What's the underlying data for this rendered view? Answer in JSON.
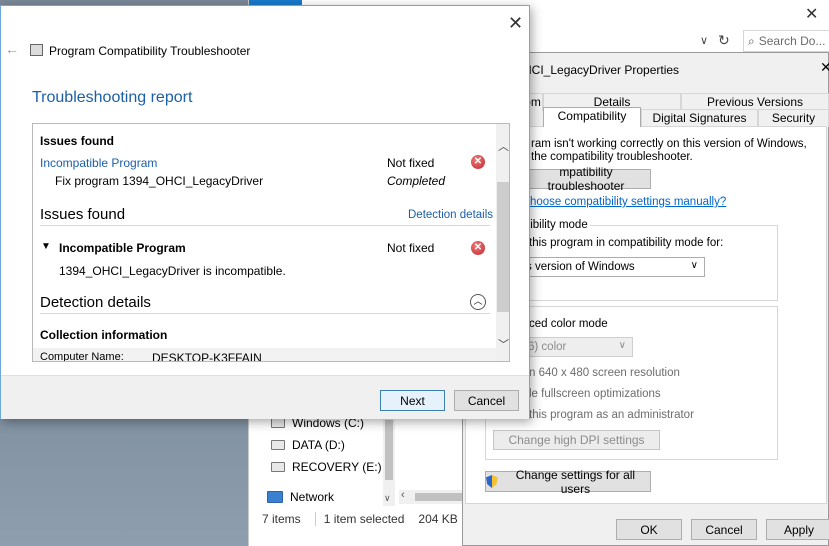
{
  "troubleshooter": {
    "app_title": "Program Compatibility Troubleshooter",
    "report_title": "Troubleshooting report",
    "summary": {
      "heading": "Issues found",
      "issue": "Incompatible Program",
      "issue_status": "Not fixed",
      "fix": "Fix program 1394_OHCI_LegacyDriver",
      "fix_status": "Completed"
    },
    "issues_section": {
      "heading": "Issues found",
      "detail_link": "Detection details",
      "issue": "Incompatible Program",
      "issue_status": "Not fixed",
      "issue_desc": "1394_OHCI_LegacyDriver is incompatible."
    },
    "detection": {
      "heading": "Detection details",
      "collection": "Collection information",
      "computer_label": "Computer Name:",
      "computer_value": "DESKTOP-K3FFAIN"
    },
    "next_label": "Next",
    "cancel_label": "Cancel"
  },
  "properties": {
    "title": "HCI_LegacyDriver Properties",
    "tabs_row1": [
      "om",
      "Details",
      "Previous Versions"
    ],
    "tabs_row2": [
      "Compatibility",
      "Digital Signatures",
      "Security"
    ],
    "desc_line1": "ram isn't working correctly on this version of Windows,",
    "desc_line2": "the compatibility troubleshooter.",
    "run_troubleshooter": "mpatibility troubleshooter",
    "manual_link": "hoose compatibility settings manually?",
    "compat_group": "tibility mode",
    "compat_check": "this program in compatibility mode for:",
    "compat_select": "s version of Windows",
    "reduced_color": "ced color mode",
    "color_select": "6) color",
    "opt_resolution": "n 640 x 480 screen resolution",
    "opt_fullscreen": "le fullscreen optimizations",
    "opt_admin": "this program as an administrator",
    "dpi_button": "Change high DPI settings",
    "all_users_button": "Change settings for all users",
    "ok_label": "OK",
    "cancel_label": "Cancel",
    "apply_label": "Apply"
  },
  "explorer": {
    "search_placeholder": "Search Do...",
    "nav": [
      "Windows (C:)",
      "DATA (D:)",
      "RECOVERY (E:)",
      "Network"
    ],
    "status_items": "7 items",
    "status_selected": "1 item selected",
    "status_size": "204 KB"
  }
}
